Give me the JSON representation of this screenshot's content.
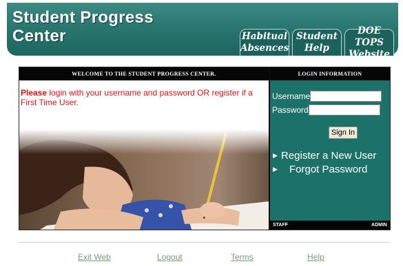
{
  "header": {
    "title_line1": "Student Progress",
    "title_line2": "Center",
    "tabs": [
      {
        "line1": "Habitual",
        "line2": "Absences"
      },
      {
        "line1": "Student",
        "line2": "Help"
      },
      {
        "line1": "DOE TOPS",
        "line2": "Website"
      }
    ]
  },
  "welcome": {
    "bar_title": "Welcome to the Student Progress Center.",
    "message_bold": "Please",
    "message_rest": " login with your username and password OR register if a First Time User."
  },
  "login": {
    "bar_title": "Login Information",
    "username_label": "Username",
    "username_value": "",
    "password_label": "Password",
    "password_value": "",
    "signin_label": "Sign In",
    "register_label": "Register a New User",
    "forgot_label": "Forgot Password",
    "footer_left": "STAFF",
    "footer_right": "ADMIN"
  },
  "footer": {
    "links": [
      "Exit Web",
      "Logout",
      "Terms",
      "Help"
    ]
  },
  "colors": {
    "banner": "#2a7770",
    "login_panel": "#1c7268",
    "message": "#e01010",
    "footer_link": "#7a9a7a"
  }
}
